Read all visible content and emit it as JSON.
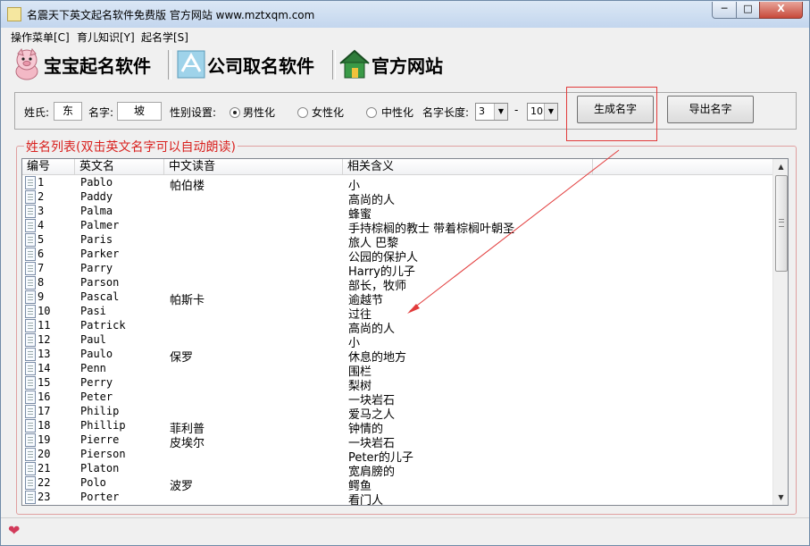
{
  "window": {
    "title": "名震天下英文起名软件免费版  官方网站 www.mztxqm.com",
    "min_label": "─",
    "max_label": "□",
    "close_label": "X"
  },
  "menu": [
    "操作菜单[C]",
    "育儿知识[Y]",
    "起名学[S]"
  ],
  "toolbar": {
    "baby": "宝宝起名软件",
    "company": "公司取名软件",
    "site": "官方网站"
  },
  "settings": {
    "surname_label": "姓氏:",
    "surname_value": "东",
    "name_label": "名字:",
    "name_value": "坡",
    "gender_label": "性别设置:",
    "male": "男性化",
    "female": "女性化",
    "neutral": "中性化",
    "gender_selected": "男性化",
    "length_label": "名字长度:",
    "length_min": "3",
    "length_dash": "-",
    "length_max": "10",
    "generate": "生成名字",
    "export": "导出名字"
  },
  "list": {
    "group_title": "姓名列表(双击英文名字可以自动朗读)",
    "headers": [
      "编号",
      "英文名",
      "中文读音",
      "相关含义"
    ],
    "rows": [
      {
        "no": "1",
        "en": "Pablo",
        "cn": "帕伯楼",
        "meaning": "小"
      },
      {
        "no": "2",
        "en": "Paddy",
        "cn": "",
        "meaning": "高尚的人"
      },
      {
        "no": "3",
        "en": "Palma",
        "cn": "",
        "meaning": "蜂蜜"
      },
      {
        "no": "4",
        "en": "Palmer",
        "cn": "",
        "meaning": "手持棕榈的教士 带着棕榈叶朝圣"
      },
      {
        "no": "5",
        "en": "Paris",
        "cn": "",
        "meaning": "旅人 巴黎"
      },
      {
        "no": "6",
        "en": "Parker",
        "cn": "",
        "meaning": "公园的保护人"
      },
      {
        "no": "7",
        "en": "Parry",
        "cn": "",
        "meaning": "Harry的儿子"
      },
      {
        "no": "8",
        "en": "Parson",
        "cn": "",
        "meaning": "部长，牧师"
      },
      {
        "no": "9",
        "en": "Pascal",
        "cn": "帕斯卡",
        "meaning": "逾越节"
      },
      {
        "no": "10",
        "en": "Pasi",
        "cn": "",
        "meaning": "过往"
      },
      {
        "no": "11",
        "en": "Patrick",
        "cn": "",
        "meaning": "高尚的人"
      },
      {
        "no": "12",
        "en": "Paul",
        "cn": "",
        "meaning": "小"
      },
      {
        "no": "13",
        "en": "Paulo",
        "cn": "保罗",
        "meaning": "休息的地方"
      },
      {
        "no": "14",
        "en": "Penn",
        "cn": "",
        "meaning": "围栏"
      },
      {
        "no": "15",
        "en": "Perry",
        "cn": "",
        "meaning": "梨树"
      },
      {
        "no": "16",
        "en": "Peter",
        "cn": "",
        "meaning": "一块岩石"
      },
      {
        "no": "17",
        "en": "Philip",
        "cn": "",
        "meaning": "爱马之人"
      },
      {
        "no": "18",
        "en": "Phillip",
        "cn": "菲利普",
        "meaning": "钟情的"
      },
      {
        "no": "19",
        "en": "Pierre",
        "cn": "皮埃尔",
        "meaning": "一块岩石"
      },
      {
        "no": "20",
        "en": "Pierson",
        "cn": "",
        "meaning": "Peter的儿子"
      },
      {
        "no": "21",
        "en": "Platon",
        "cn": "",
        "meaning": "宽肩膀的"
      },
      {
        "no": "22",
        "en": "Polo",
        "cn": "波罗",
        "meaning": "鳄鱼"
      },
      {
        "no": "23",
        "en": "Porter",
        "cn": "",
        "meaning": "看门人"
      }
    ]
  },
  "colors": {
    "accent_red": "#e23b3b",
    "group_title_red": "#d9221f"
  },
  "icons": {
    "app": "app-icon",
    "baby": "pig-mascot-icon",
    "company": "company-logo-icon",
    "site": "house-icon",
    "status": "heart-icon"
  }
}
